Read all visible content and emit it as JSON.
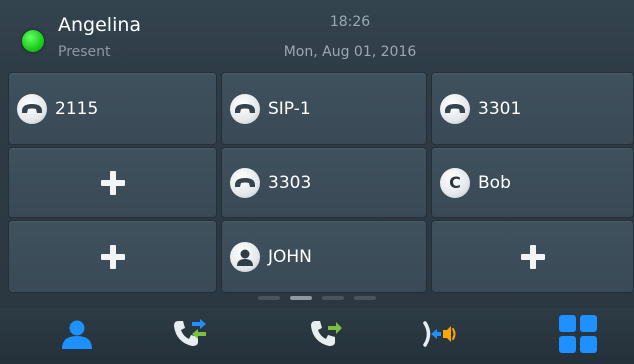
{
  "status": {
    "user_name": "Angelina",
    "presence": "Present",
    "time": "18:26",
    "date": "Mon, Aug 01, 2016"
  },
  "keys": [
    {
      "type": "line",
      "label": "2115",
      "icon": "handset-icon"
    },
    {
      "type": "line",
      "label": "SIP-1",
      "icon": "handset-icon"
    },
    {
      "type": "line",
      "label": "3301",
      "icon": "handset-icon"
    },
    {
      "type": "add",
      "label": "",
      "icon": "plus-icon"
    },
    {
      "type": "line",
      "label": "3303",
      "icon": "handset-icon"
    },
    {
      "type": "contact",
      "label": "Bob",
      "icon": "contact-letter-icon",
      "letter": "C"
    },
    {
      "type": "add",
      "label": "",
      "icon": "plus-icon"
    },
    {
      "type": "contact",
      "label": "JOHN",
      "icon": "person-icon"
    },
    {
      "type": "add",
      "label": "",
      "icon": "plus-icon"
    }
  ],
  "pager": {
    "pages": 4,
    "active_index": 1
  },
  "toolbar": [
    {
      "icon": "contacts-icon"
    },
    {
      "icon": "call-transfer-icon"
    },
    {
      "icon": "call-forward-icon"
    },
    {
      "icon": "intercom-icon"
    },
    {
      "icon": "menu-grid-icon"
    }
  ],
  "colors": {
    "presence_green": "#1ed21e",
    "accent_blue": "#1e90ff",
    "accent_green": "#7ac142",
    "accent_orange": "#ffa500"
  }
}
